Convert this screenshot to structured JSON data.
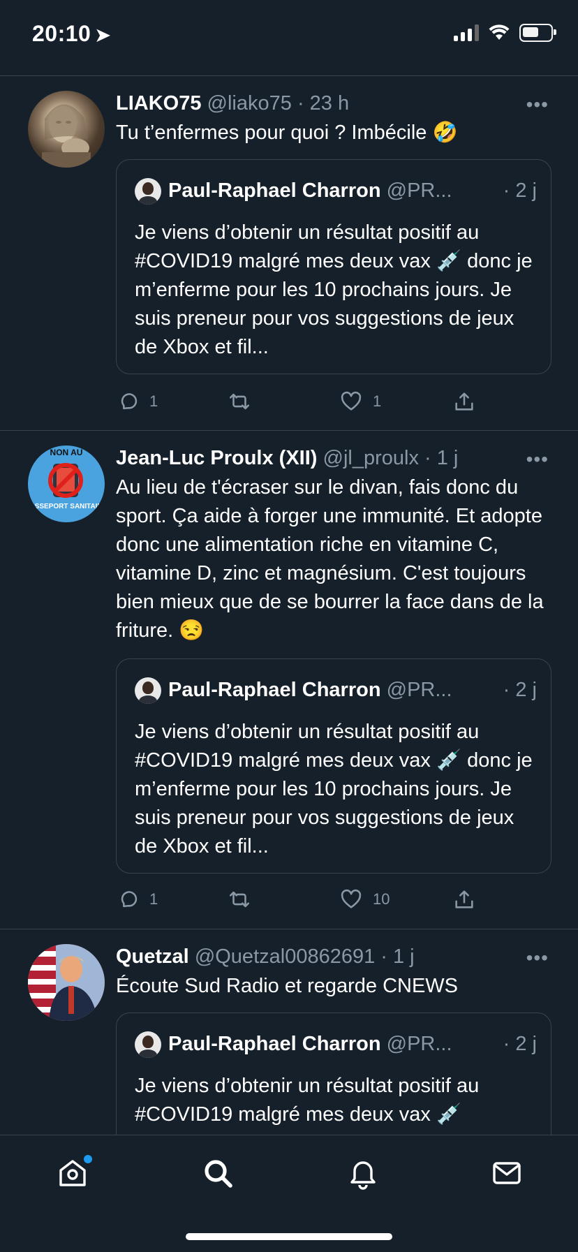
{
  "status_bar": {
    "time": "20:10",
    "location_arrow": "➤"
  },
  "tweets": [
    {
      "name": "LIAKO75",
      "handle": "@liako75 · 23 h",
      "text": "Tu t’enfermes pour quoi ? Imbécile 🤣",
      "quote": {
        "name": "Paul-Raphael Charron",
        "handle": "@PR...",
        "date": "· 2 j",
        "text": "Je viens d’obtenir un résultat positif au #COVID19 malgré mes deux vax 💉 donc je m’enferme pour les 10 prochains jours. Je suis preneur pour vos suggestions de jeux de Xbox et fil..."
      },
      "replies": "1",
      "retweets": "",
      "likes": "1"
    },
    {
      "name": "Jean-Luc Proulx (XII)",
      "handle": "@jl_proulx · 1 j",
      "text": "Au lieu de t'écraser sur le divan, fais donc du sport. Ça aide à forger une immunité. Et adopte donc une alimentation riche en vitamine C, vitamine D, zinc et magnésium. C'est toujours bien mieux que de se bourrer la face dans de la friture. 😒",
      "avatar_text": {
        "top": "NON AU",
        "bottom": "PASSEPORT SANITAIRE"
      },
      "quote": {
        "name": "Paul-Raphael Charron",
        "handle": "@PR...",
        "date": "· 2 j",
        "text": "Je viens d’obtenir un résultat positif au #COVID19 malgré mes deux vax 💉 donc je m’enferme pour les 10 prochains jours. Je suis preneur pour vos suggestions de jeux de Xbox et fil..."
      },
      "replies": "1",
      "retweets": "",
      "likes": "10"
    },
    {
      "name": "Quetzal",
      "handle": "@Quetzal00862691 · 1 j",
      "text": "Écoute Sud Radio et regarde CNEWS",
      "quote": {
        "name": "Paul-Raphael Charron",
        "handle": "@PR...",
        "date": "· 2 j",
        "text": "Je viens d’obtenir un résultat positif au #COVID19 malgré mes deux vax 💉"
      }
    }
  ],
  "more_label": "•••",
  "icons": {
    "reply": "reply-icon",
    "retweet": "retweet-icon",
    "like": "heart-icon",
    "share": "share-icon",
    "home": "home-icon",
    "search": "search-icon",
    "notifications": "bell-icon",
    "messages": "mail-icon"
  },
  "colors": {
    "background": "#15202b",
    "border": "#38444d",
    "secondary_text": "#8b98a5",
    "accent": "#1d9bf0"
  }
}
